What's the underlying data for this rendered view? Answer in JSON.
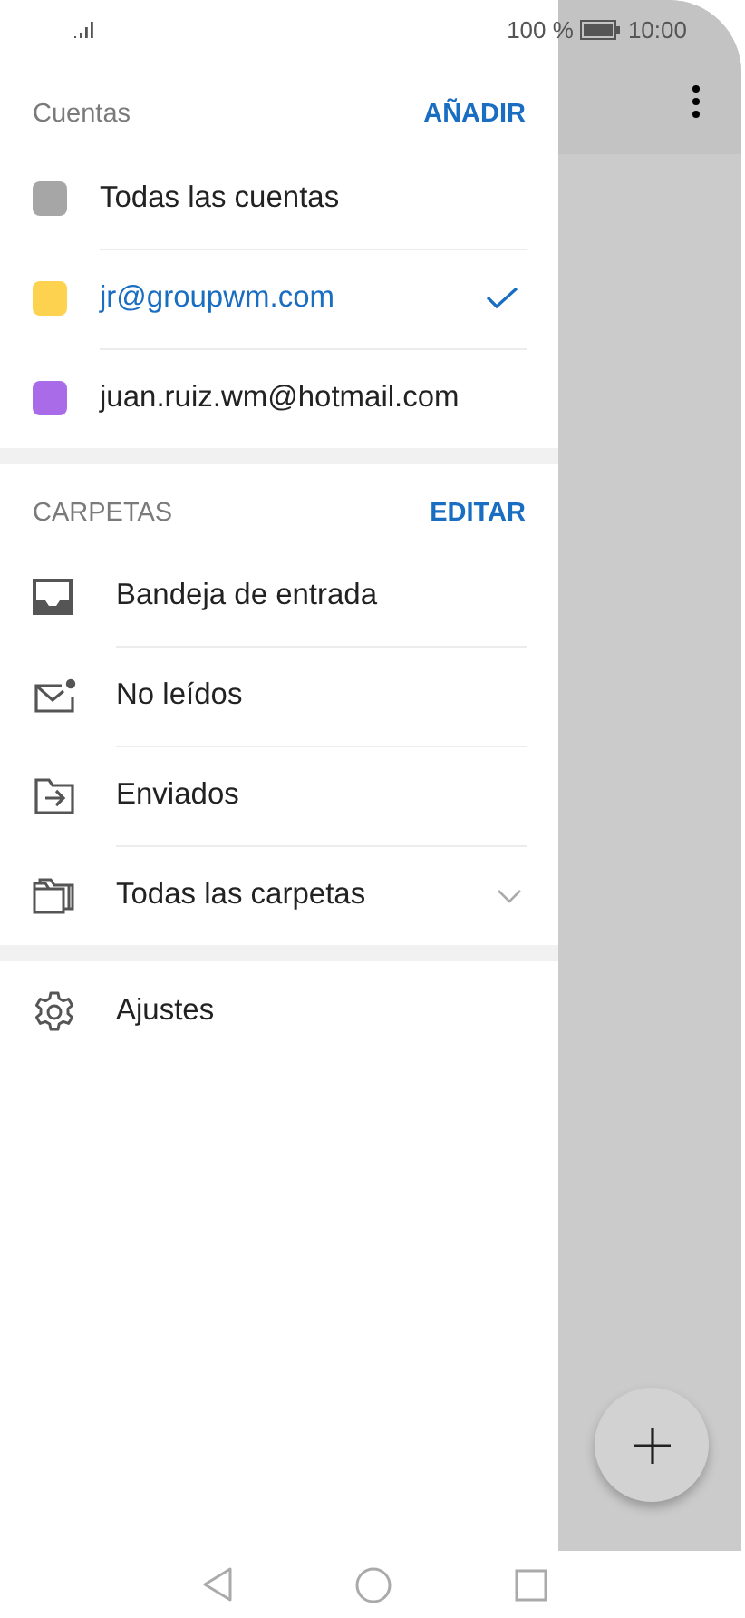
{
  "status_bar": {
    "battery_text": "100 %",
    "time": "10:00"
  },
  "accounts": {
    "title": "Cuentas",
    "action": "AÑADIR",
    "items": [
      {
        "name": "Todas las cuentas",
        "color": "#a6a6a6",
        "selected": false
      },
      {
        "name": "jr@groupwm.com",
        "color": "#fdd24f",
        "selected": true
      },
      {
        "name": "juan.ruiz.wm@hotmail.com",
        "color": "#a96be8",
        "selected": false
      }
    ]
  },
  "folders": {
    "title": "CARPETAS",
    "action": "EDITAR",
    "items": [
      {
        "label": "Bandeja de entrada",
        "kind": "inbox",
        "expandable": false
      },
      {
        "label": "No leídos",
        "kind": "unread",
        "expandable": false
      },
      {
        "label": "Enviados",
        "kind": "sent",
        "expandable": false
      },
      {
        "label": "Todas las carpetas",
        "kind": "all",
        "expandable": true
      }
    ]
  },
  "settings": {
    "label": "Ajustes"
  }
}
